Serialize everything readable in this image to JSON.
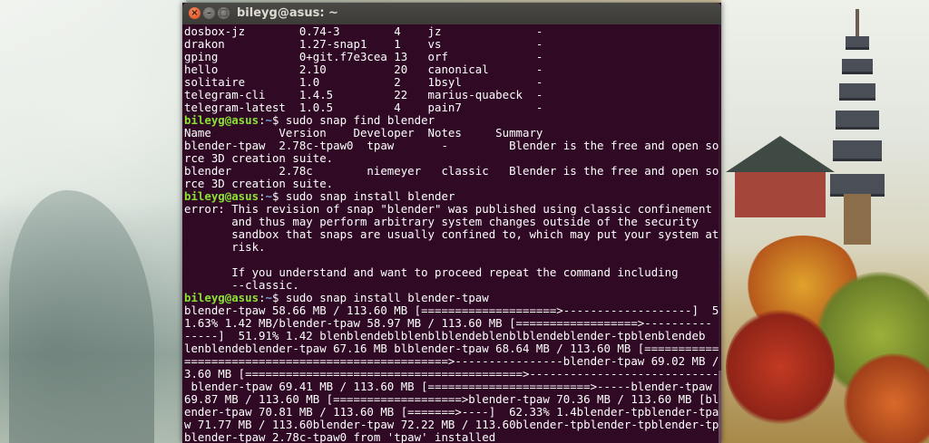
{
  "window": {
    "title": "bileyg@asus: ~"
  },
  "prompt": {
    "user_host": "bileyg@asus",
    "cwd": "~",
    "symbol": "$"
  },
  "terminal": {
    "lines": [
      "dosbox-jz        0.74-3        4    jz              -",
      "drakon           1.27-snap1    1    vs              -",
      "gping            0+git.f7e3cea 13   orf             -",
      "hello            2.10          20   canonical       -",
      "solitaire        1.0           2    1bsyl           -",
      "telegram-cli     1.4.5         22   marius-quabeck  -",
      "telegram-latest  1.0.5         4    pain7           -"
    ],
    "cmd1": " sudo snap find blender",
    "find_output": [
      "Name          Version    Developer  Notes     Summary",
      "blender-tpaw  2.78c-tpaw0  tpaw       -         Blender is the free and open sou",
      "rce 3D creation suite.",
      "blender       2.78c        niemeyer   classic   Blender is the free and open sou",
      "rce 3D creation suite."
    ],
    "cmd2": " sudo snap install blender",
    "error_output": [
      "error: This revision of snap \"blender\" was published using classic confinement",
      "       and thus may perform arbitrary system changes outside of the security",
      "       sandbox that snaps are usually confined to, which may put your system at",
      "       risk.",
      "",
      "       If you understand and want to proceed repeat the command including",
      "       --classic."
    ],
    "cmd3": " sudo snap install blender-tpaw",
    "progress_output": [
      "blender-tpaw 58.66 MB / 113.60 MB [====================>-------------------]  5",
      "1.63% 1.42 MB/blender-tpaw 58.97 MB / 113.60 MB [==================>----------",
      "-----]  51.91% 1.42 blenblendeblblenblblendeblenblblendeblender-tpblenblendeb",
      "lenblendeblender-tpaw 67.16 MB blblender-tpaw 68.64 MB / 113.60 MB [===========",
      "=======================================>----------------blender-tpaw 69.02 MB / 11",
      "3.60 MB [=========================================>----------------------------",
      " blender-tpaw 69.41 MB / 113.60 MB [========================>-----blender-tpaw",
      "69.87 MB / 113.60 MB [===================>blender-tpaw 70.36 MB / 113.60 MB [bl",
      "ender-tpaw 70.81 MB / 113.60 MB [=======>----]  62.33% 1.4blender-tpblender-tpa",
      "w 71.77 MB / 113.60blender-tpaw 72.22 MB / 113.60blender-tpblender-tpblender-tp",
      "blender-tpaw 2.78c-tpaw0 from 'tpaw' installed"
    ]
  },
  "colors": {
    "terminal_bg": "#300a24",
    "prompt_user": "#8ae234",
    "prompt_dir": "#729fcf",
    "close_button": "#df4a16"
  },
  "icons": {
    "close": "close-icon",
    "minimize": "minimize-icon",
    "maximize": "maximize-icon"
  }
}
